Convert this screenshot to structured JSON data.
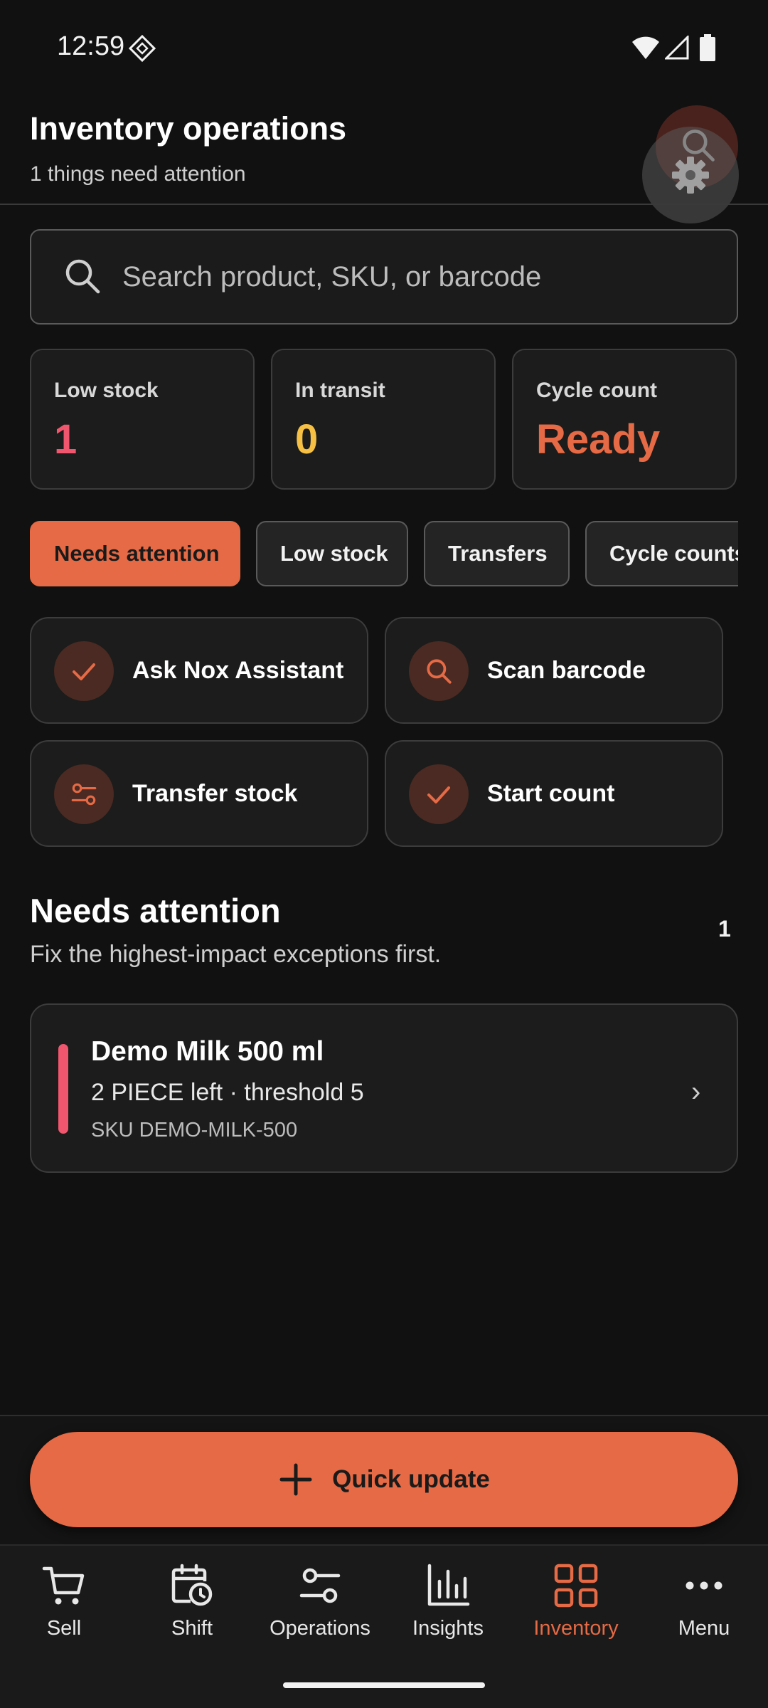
{
  "status_bar": {
    "time": "12:59"
  },
  "header": {
    "title": "Inventory operations",
    "subtitle": "1 things need attention"
  },
  "search": {
    "placeholder": "Search product, SKU, or barcode"
  },
  "stats": [
    {
      "label": "Low stock",
      "value": "1",
      "color": "#f0566d"
    },
    {
      "label": "In transit",
      "value": "0",
      "color": "#f5c044"
    },
    {
      "label": "Cycle count",
      "value": "Ready",
      "color": "#e56a45"
    }
  ],
  "filters": [
    {
      "label": "Needs attention",
      "active": true
    },
    {
      "label": "Low stock",
      "active": false
    },
    {
      "label": "Transfers",
      "active": false
    },
    {
      "label": "Cycle counts",
      "active": false
    }
  ],
  "actions": [
    {
      "label": "Ask Nox Assistant",
      "icon": "check-icon"
    },
    {
      "label": "Scan barcode",
      "icon": "search-icon"
    },
    {
      "label": "Transfer stock",
      "icon": "sliders-icon"
    },
    {
      "label": "Start count",
      "icon": "check-icon"
    }
  ],
  "section": {
    "title": "Needs attention",
    "subtitle": "Fix the highest-impact exceptions first.",
    "count": "1"
  },
  "alerts": [
    {
      "title": "Demo Milk 500 ml",
      "detail": "2 PIECE left · threshold 5",
      "sku": "SKU DEMO-MILK-500",
      "severity_color": "#f0566d"
    }
  ],
  "quick_update": {
    "label": "Quick update"
  },
  "nav": [
    {
      "label": "Sell",
      "icon": "cart-icon",
      "active": false
    },
    {
      "label": "Shift",
      "icon": "calendar-clock-icon",
      "active": false
    },
    {
      "label": "Operations",
      "icon": "sliders-icon",
      "active": false
    },
    {
      "label": "Insights",
      "icon": "bar-chart-icon",
      "active": false
    },
    {
      "label": "Inventory",
      "icon": "grid-icon",
      "active": true
    },
    {
      "label": "Menu",
      "icon": "more-icon",
      "active": false
    }
  ],
  "colors": {
    "accent": "#e56a45",
    "danger": "#f0566d",
    "warning": "#f5c044",
    "background": "#111111"
  }
}
